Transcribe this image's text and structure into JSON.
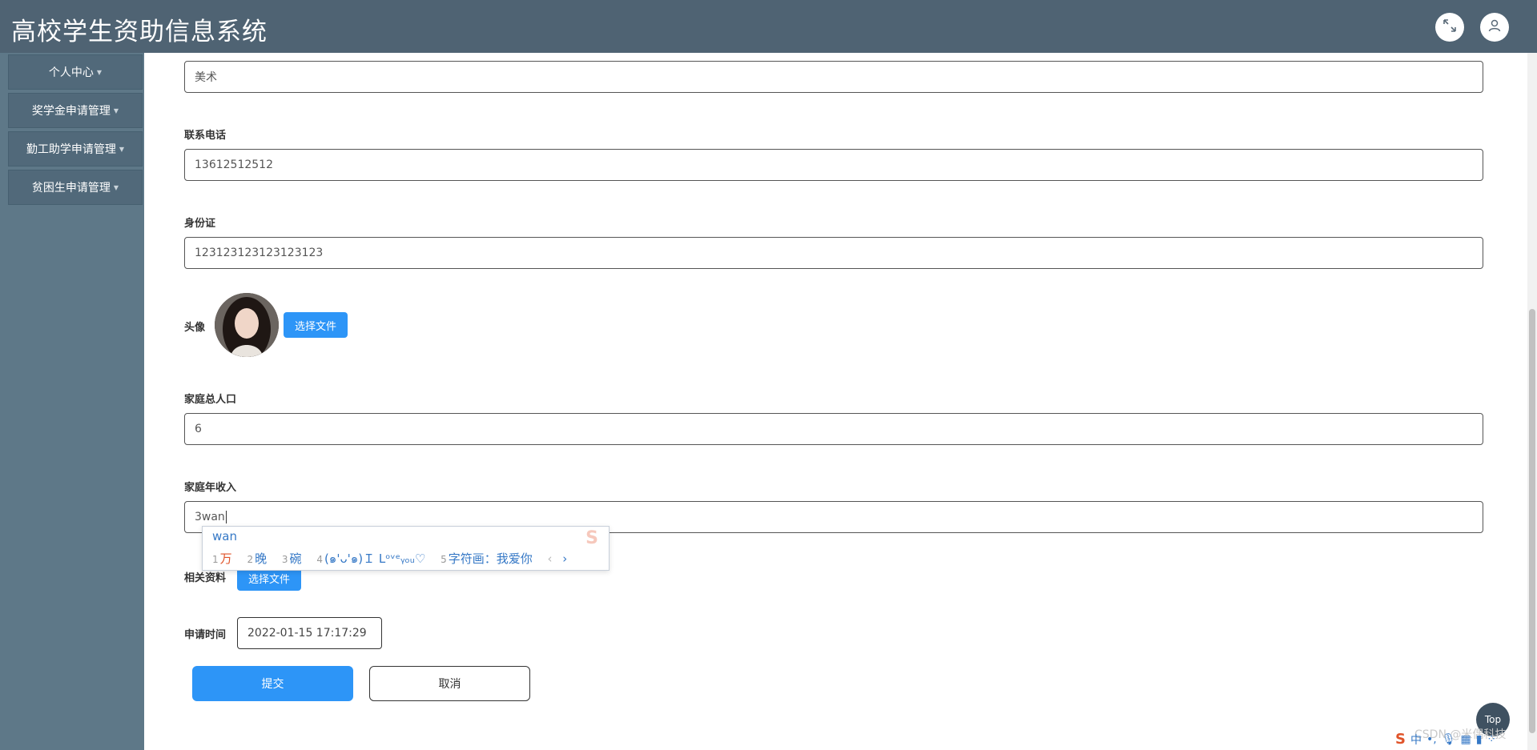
{
  "header": {
    "title": "高校学生资助信息系统",
    "fullscreen_icon": "expand-icon",
    "user_icon": "user-icon"
  },
  "sidebar": {
    "items": [
      {
        "label": "个人中心"
      },
      {
        "label": "奖学金申请管理"
      },
      {
        "label": "勤工助学申请管理"
      },
      {
        "label": "贫困生申请管理"
      }
    ]
  },
  "form": {
    "major_value": "美术",
    "phone_label": "联系电话",
    "phone_value": "13612512512",
    "id_label": "身份证",
    "id_value": "123123123123123123",
    "avatar_label": "头像",
    "avatar_button": "选择文件",
    "family_size_label": "家庭总人口",
    "family_size_value": "6",
    "income_label": "家庭年收入",
    "income_value": "3wan",
    "docs_label": "相关资料",
    "docs_button": "选择文件",
    "apply_time_label": "申请时间",
    "apply_time_value": "2022-01-15 17:17:29",
    "submit_label": "提交",
    "cancel_label": "取消"
  },
  "ime": {
    "composition": "wan",
    "candidates": [
      {
        "num": "1",
        "text": "万"
      },
      {
        "num": "2",
        "text": "晚"
      },
      {
        "num": "3",
        "text": "碗"
      },
      {
        "num": "4",
        "text": "(๑'ᴗ'๑)Ｉ Lᵒᵛᵉᵧₒᵤ♡"
      },
      {
        "num": "5",
        "text": "字符画：我爱你"
      }
    ],
    "prev": "‹",
    "next": "›"
  },
  "misc": {
    "top_button": "Top",
    "watermark": "CSDN @米偶科技",
    "tray_lang": "中"
  },
  "colors": {
    "header_bg": "#4f6373",
    "sidebar_bg": "#5e7888",
    "accent": "#2d95f7"
  }
}
